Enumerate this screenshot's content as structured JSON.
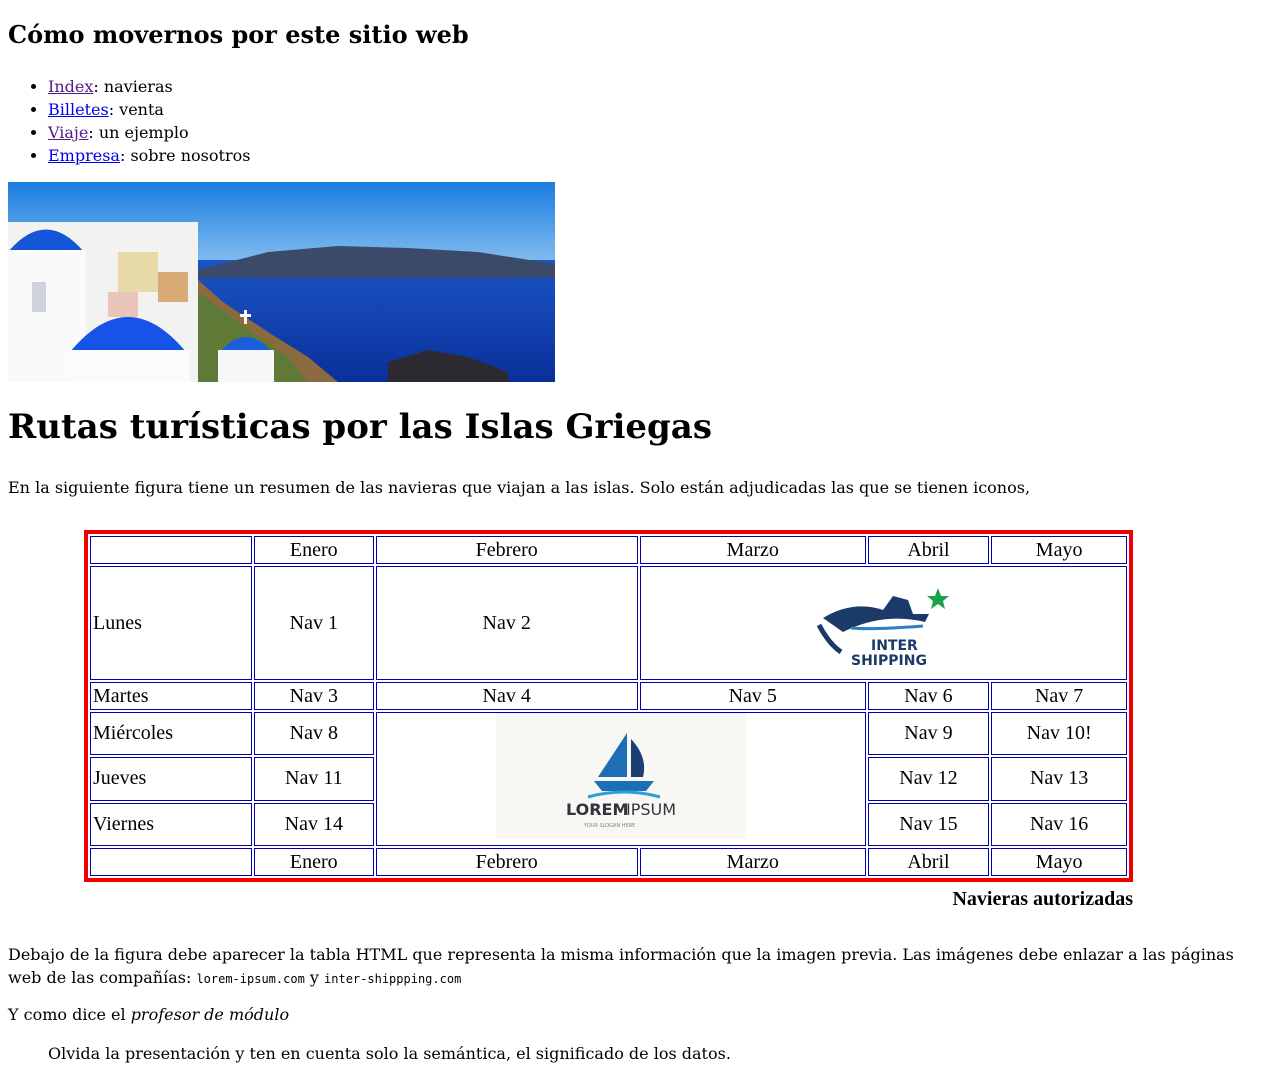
{
  "nav": {
    "title": "Cómo movernos por este sitio web",
    "items": [
      {
        "link": "Index",
        "desc": ": navieras"
      },
      {
        "link": "Billetes",
        "desc": ": venta"
      },
      {
        "link": "Viaje",
        "desc": ": un ejemplo"
      },
      {
        "link": "Empresa",
        "desc": ": sobre nosotros"
      }
    ]
  },
  "main": {
    "title": "Rutas turísticas por las Islas Griegas",
    "intro": "En la siguiente figura tiene un resumen de las navieras que viajan a las islas. Solo están adjudicadas las que se tienen iconos,"
  },
  "table": {
    "months": [
      "Enero",
      "Febrero",
      "Marzo",
      "Abril",
      "Mayo"
    ],
    "days": [
      "Lunes",
      "Martes",
      "Miércoles",
      "Jueves",
      "Viernes"
    ],
    "cells": {
      "lunes": [
        "Nav 1",
        "Nav 2"
      ],
      "martes": [
        "Nav 3",
        "Nav 4",
        "Nav 5",
        "Nav 6",
        "Nav 7"
      ],
      "miercoles": [
        "Nav 8",
        "Nav 9",
        "Nav 10!"
      ],
      "jueves": [
        "Nav 11",
        "Nav 12",
        "Nav 13"
      ],
      "viernes": [
        "Nav 14",
        "Nav 15",
        "Nav 16"
      ]
    },
    "logo_inter": {
      "line1": "INTER",
      "line2": "SHIPPING"
    },
    "logo_lorem": {
      "name_a": "LOREM",
      "name_b": "IPSUM",
      "slogan": "YOUR SLOGAN HERE"
    },
    "caption": "Navieras autorizadas"
  },
  "desc": {
    "text_a": "Debajo de la figura debe aparecer la tabla HTML que representa la misma información que la imagen previa. Las imágenes debe enlazar a las páginas web de las compañías: ",
    "code_a": "lorem-ipsum.com",
    "text_b": " y ",
    "code_b": "inter-shippping.com"
  },
  "quote": {
    "intro": "Y como dice el ",
    "intro_em": "profesor de módulo",
    "text": "Olvida la presentación y ten en cuenta solo la semántica, el significado de los datos."
  },
  "colors": {
    "table_border": "#ee0000",
    "cell_border": "#0000aa",
    "link": "#0000ee",
    "visited": "#551a8b"
  }
}
